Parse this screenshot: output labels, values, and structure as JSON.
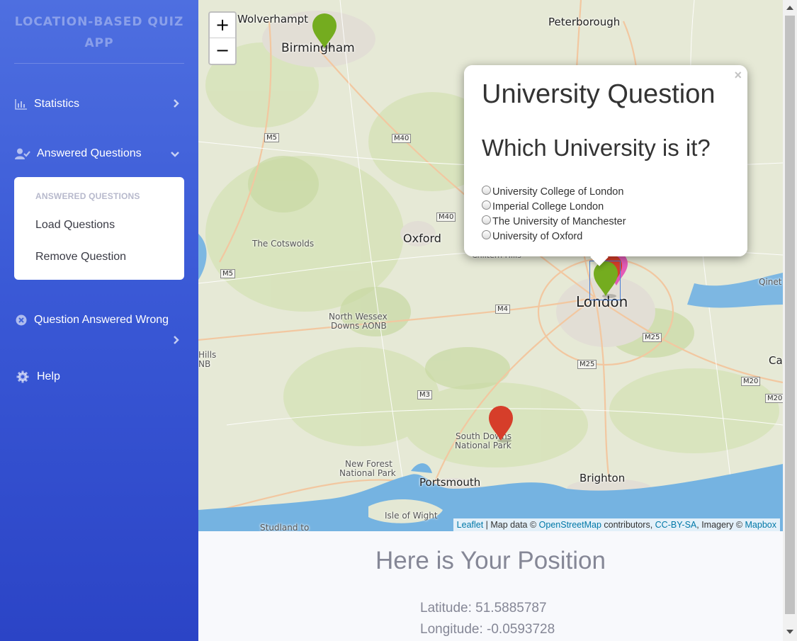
{
  "app": {
    "brand": "LOCATION-BASED QUIZ APP"
  },
  "sidebar": {
    "statistics": "Statistics",
    "answered_questions": "Answered Questions",
    "submenu": {
      "header": "ANSWERED QUESTIONS",
      "items": [
        "Load Questions",
        "Remove Question"
      ]
    },
    "question_answered_wrong": "Question Answered Wrong",
    "help": "Help"
  },
  "map": {
    "zoom_in": "+",
    "zoom_out": "−",
    "labels": {
      "wolverhampton": "Wolverhampt",
      "birmingham": "Birmingham",
      "peterborough": "Peterborough",
      "oxford": "Oxford",
      "cotswolds": "The Cotswolds",
      "london": "London",
      "north_wessex_1": "North Wessex",
      "north_wessex_2": "Downs AONB",
      "south_downs_1": "South Downs",
      "south_downs_2": "National Park",
      "new_forest_1": "New Forest",
      "new_forest_2": "National Park",
      "portsmouth": "Portsmouth",
      "brighton": "Brighton",
      "isle_of_wight": "Isle of Wight",
      "studland": "Studland to",
      "chiltern": "Chiltern Hills",
      "hills": "Hills",
      "nb": "NB",
      "qinet": "Qinet",
      "ca": "Ca"
    },
    "roads": [
      "M5",
      "M40",
      "M40",
      "M5",
      "M4",
      "M3",
      "M25",
      "M25",
      "M20",
      "M20"
    ],
    "attribution": {
      "leaflet": "Leaflet",
      "text1": " | Map data © ",
      "osm": "OpenStreetMap",
      "text2": " contributors, ",
      "license": "CC-BY-SA",
      "text3": ", Imagery © ",
      "mapbox": "Mapbox"
    },
    "colors": {
      "marker_green": "#74ac1f",
      "marker_red": "#d63e2a",
      "marker_pink": "#e35bb7",
      "water": "#73b2e0",
      "land": "#e8ebd9"
    }
  },
  "popup": {
    "close": "×",
    "title": "University Question",
    "question": "Which University is it?",
    "options": [
      "University College of London",
      "Imperial College London",
      "The University of Manchester",
      "University of Oxford"
    ]
  },
  "position": {
    "heading": "Here is Your Position",
    "latitude_label": "Latitude: ",
    "latitude": "51.5885787",
    "longitude_label": "Longitude: ",
    "longitude": "-0.0593728"
  }
}
